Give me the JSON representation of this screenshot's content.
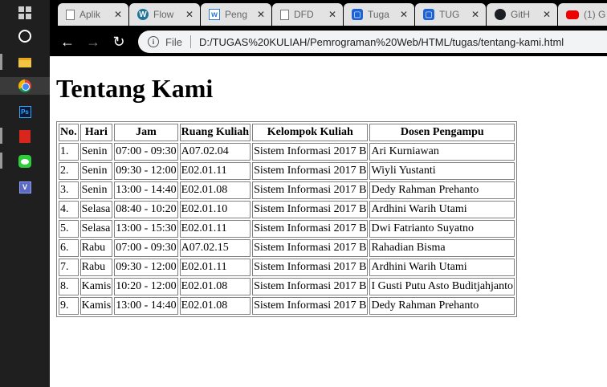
{
  "browser": {
    "tabs": [
      {
        "title": "Aplik",
        "icon": "page-icon"
      },
      {
        "title": "Flow",
        "icon": "wordpress-icon"
      },
      {
        "title": "Peng",
        "icon": "w-icon"
      },
      {
        "title": "DFD",
        "icon": "page-icon"
      },
      {
        "title": "Tuga",
        "icon": "blue-app-icon"
      },
      {
        "title": "TUG",
        "icon": "blue-app-icon"
      },
      {
        "title": "GitH",
        "icon": "github-icon"
      },
      {
        "title": "(1) G",
        "icon": "youtube-icon"
      }
    ],
    "address": {
      "file_label": "File",
      "url": "D:/TUGAS%20KULIAH/Pemrograman%20Web/HTML/tugas/tentang-kami.html"
    }
  },
  "page": {
    "heading": "Tentang Kami",
    "table": {
      "headers": [
        "No.",
        "Hari",
        "Jam",
        "Ruang Kuliah",
        "Kelompok Kuliah",
        "Dosen Pengampu"
      ],
      "rows": [
        [
          "1.",
          "Senin",
          "07:00 - 09:30",
          "A07.02.04",
          "Sistem Informasi 2017 B",
          "Ari Kurniawan"
        ],
        [
          "2.",
          "Senin",
          "09:30 - 12:00",
          "E02.01.11",
          "Sistem Informasi 2017 B",
          "Wiyli Yustanti"
        ],
        [
          "3.",
          "Senin",
          "13:00 - 14:40",
          "E02.01.08",
          "Sistem Informasi 2017 B",
          "Dedy Rahman Prehanto"
        ],
        [
          "4.",
          "Selasa",
          "08:40 - 10:20",
          "E02.01.10",
          "Sistem Informasi 2017 B",
          "Ardhini Warih Utami"
        ],
        [
          "5.",
          "Selasa",
          "13:00 - 15:30",
          "E02.01.11",
          "Sistem Informasi 2017 B",
          "Dwi Fatrianto Suyatno"
        ],
        [
          "6.",
          "Rabu",
          "07:00 - 09:30",
          "A07.02.15",
          "Sistem Informasi 2017 B",
          "Rahadian Bisma"
        ],
        [
          "7.",
          "Rabu",
          "09:30 - 12:00",
          "E02.01.11",
          "Sistem Informasi 2017 B",
          "Ardhini Warih Utami"
        ],
        [
          "8.",
          "Kamis",
          "10:20 - 12:00",
          "E02.01.08",
          "Sistem Informasi 2017 B",
          "I Gusti Putu Asto Buditjahjanto"
        ],
        [
          "9.",
          "Kamis",
          "13:00 - 14:40",
          "E02.01.08",
          "Sistem Informasi 2017 B",
          "Dedy Rahman Prehanto"
        ]
      ]
    }
  }
}
